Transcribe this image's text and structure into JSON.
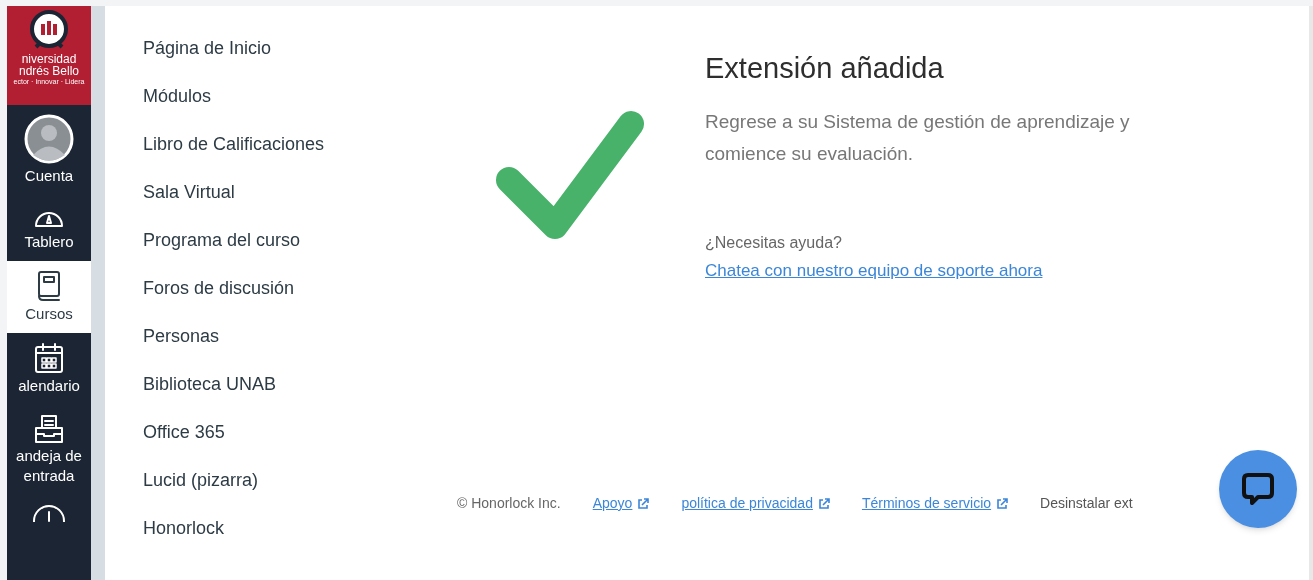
{
  "logo": {
    "lines": [
      "niversidad",
      "ndrés Bello",
      "ector · Innovar · Lidera"
    ]
  },
  "global_nav": [
    {
      "kind": "account",
      "label": "Cuenta",
      "selected": false
    },
    {
      "kind": "dashboard",
      "label": "Tablero",
      "selected": false
    },
    {
      "kind": "courses",
      "label": "Cursos",
      "selected": true
    },
    {
      "kind": "calendar",
      "label": "alendario",
      "selected": false
    },
    {
      "kind": "inbox",
      "label": "andeja de entrada",
      "selected": false
    },
    {
      "kind": "history",
      "selected": false
    }
  ],
  "course_nav": [
    "Página de Inicio",
    "Módulos",
    "Libro de Calificaciones",
    "Sala Virtual",
    "Programa del curso",
    "Foros de discusión",
    "Personas",
    "Biblioteca UNAB",
    "Office 365",
    "Lucid (pizarra)",
    "Honorlock"
  ],
  "message": {
    "title": "Extensión añadida",
    "body": "Regrese a su Sistema de gestión de aprendizaje y comience su evaluación.",
    "help_prompt": "¿Necesitas ayuda?",
    "help_link": "Chatea con nuestro equipo de soporte ahora"
  },
  "footer": {
    "copyright": "© Honorlock Inc.",
    "links": [
      "Apoyo",
      "política de privacidad",
      "Términos de servicio"
    ],
    "trailing": "Desinstalar ext"
  }
}
